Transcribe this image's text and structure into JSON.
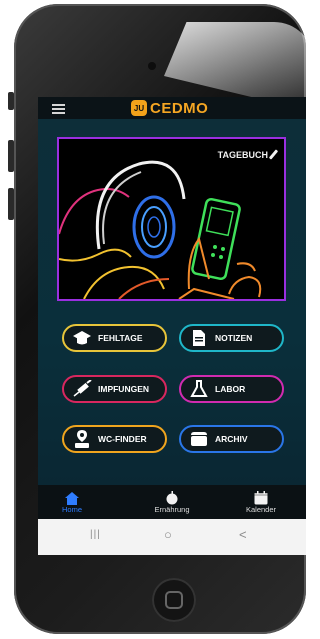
{
  "brand": {
    "name": "CEDMO",
    "logo_text": "JU"
  },
  "hero": {
    "diary_label": "TAGEBUCH"
  },
  "buttons": [
    {
      "label": "FEHLTAGE",
      "icon": "graduation-cap-icon",
      "border": "#e8c53a"
    },
    {
      "label": "NOTIZEN",
      "icon": "document-icon",
      "border": "#1fb7c9"
    },
    {
      "label": "IMPFUNGEN",
      "icon": "syringe-icon",
      "border": "#d8275f"
    },
    {
      "label": "LABOR",
      "icon": "flask-icon",
      "border": "#d12bb0"
    },
    {
      "label": "WC-FINDER",
      "icon": "wc-location-icon",
      "border": "#f0a51e"
    },
    {
      "label": "ARCHIV",
      "icon": "archive-box-icon",
      "border": "#2a76e8"
    }
  ],
  "nav": [
    {
      "label": "Home",
      "icon": "home-icon",
      "active": true
    },
    {
      "label": "Ernährung",
      "icon": "apple-icon",
      "active": false
    },
    {
      "label": "Kalender",
      "icon": "calendar-icon",
      "active": false
    }
  ],
  "system_nav": {
    "recents": "|||",
    "home": "○",
    "back": "<"
  },
  "colors": {
    "accent": "#f5a623",
    "active_nav": "#2f7dff",
    "hero_border": "#9a2fe0"
  }
}
